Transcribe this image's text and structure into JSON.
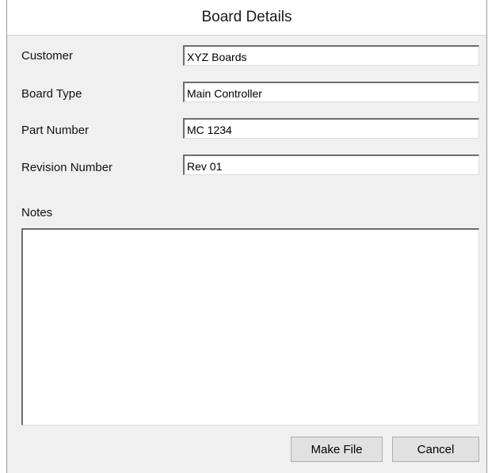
{
  "window": {
    "title": "Board Details"
  },
  "fields": {
    "customer": {
      "label": "Customer",
      "value": "XYZ Boards"
    },
    "board_type": {
      "label": "Board Type",
      "value": "Main Controller"
    },
    "part_number": {
      "label": "Part Number",
      "value": "MC 1234"
    },
    "revision_number": {
      "label": "Revision Number",
      "value": "Rev 01"
    }
  },
  "notes": {
    "label": "Notes",
    "value": ""
  },
  "buttons": {
    "make_file": "Make File",
    "cancel": "Cancel"
  }
}
